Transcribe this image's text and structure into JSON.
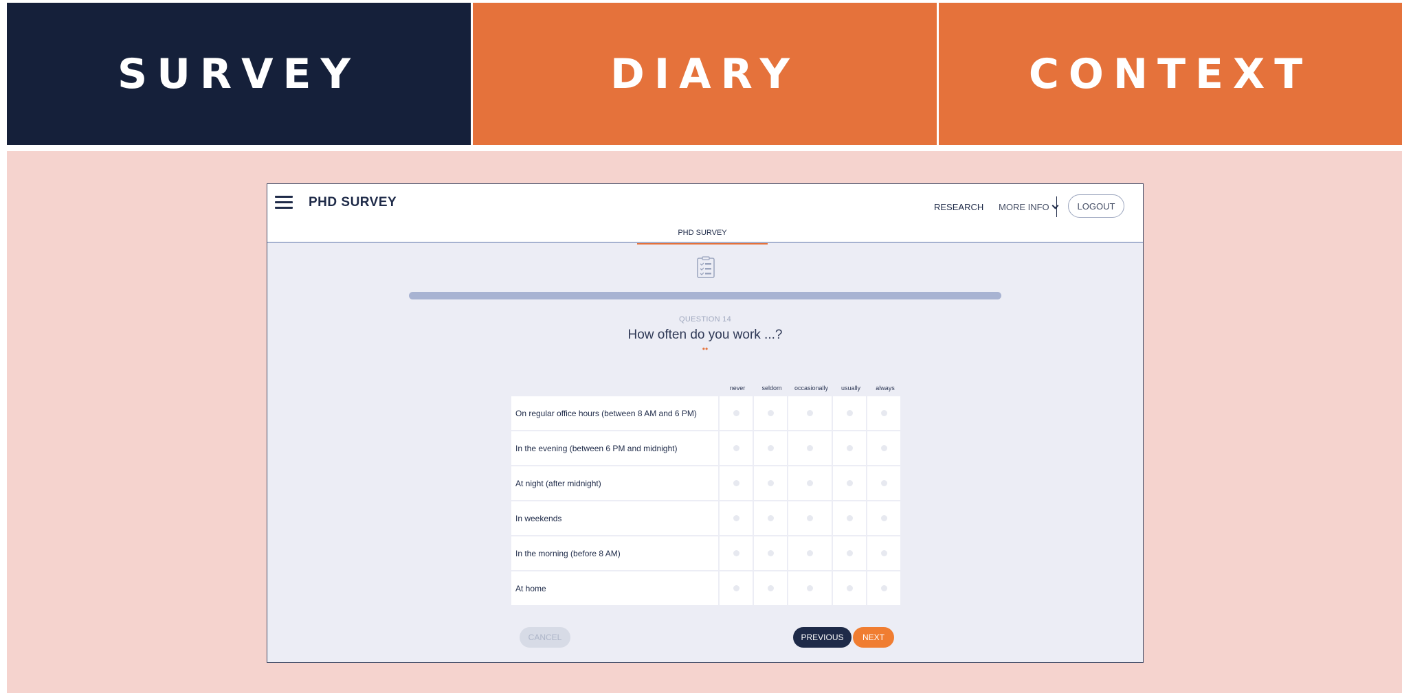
{
  "top_tabs": {
    "survey": "SURVEY",
    "diary": "DIARY",
    "context": "CONTEXT"
  },
  "app": {
    "title": "PHD SURVEY",
    "nav": {
      "research": "RESEARCH",
      "more_info": "MORE INFO",
      "logout": "LOGOUT"
    },
    "sub_tab": "PHD SURVEY"
  },
  "question": {
    "label": "QUESTION 14",
    "text": "How often do you work ...?",
    "dots": "••"
  },
  "scale": [
    "never",
    "seldom",
    "occasionally",
    "usually",
    "always"
  ],
  "rows": [
    "On regular office hours (between 8 AM and 6 PM)",
    "In the evening (between 6 PM and midnight)",
    "At night (after midnight)",
    "In weekends",
    "In the morning (before 8 AM)",
    "At home"
  ],
  "buttons": {
    "cancel": "CANCEL",
    "previous": "PREVIOUS",
    "next": "NEXT"
  },
  "colors": {
    "navy": "#15203a",
    "orange": "#e5723b",
    "panel": "#f5d3ce",
    "app_bg": "#ecedf5"
  },
  "icons": {
    "menu": "hamburger-menu-icon",
    "survey": "checklist-icon",
    "dropdown": "chevron-down-icon"
  }
}
